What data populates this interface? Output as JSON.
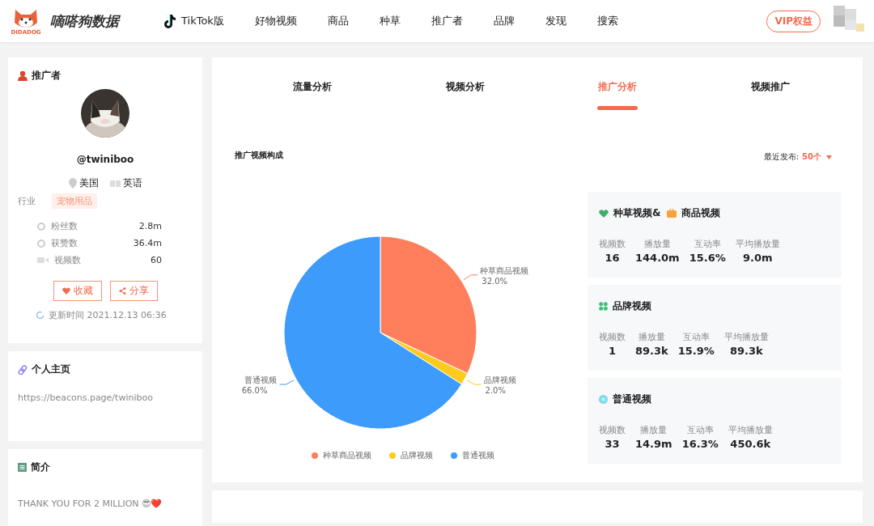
{
  "header": {
    "brand": "嘀嗒狗数据",
    "logo_caption": "DIDADOG",
    "nav": [
      {
        "label": "TikTok版",
        "kind": "tiktok"
      },
      {
        "label": "好物视频"
      },
      {
        "label": "商品"
      },
      {
        "label": "种草"
      },
      {
        "label": "推广者"
      },
      {
        "label": "品牌"
      },
      {
        "label": "发现"
      },
      {
        "label": "搜索"
      }
    ],
    "vip_button": "VIP权益"
  },
  "profile": {
    "section_title": "推广者",
    "handle": "@twiniboo",
    "country": "美国",
    "language": "英语",
    "industry_label": "行业",
    "industry": "宠物用品",
    "stats": [
      {
        "kind": "fans",
        "label": "粉丝数",
        "value": "2.8m"
      },
      {
        "kind": "likes",
        "label": "获赞数",
        "value": "36.4m"
      },
      {
        "kind": "videos",
        "label": "视频数",
        "value": "60"
      }
    ],
    "buttons": [
      {
        "kind": "favorite",
        "label": "收藏"
      },
      {
        "kind": "share",
        "label": "分享"
      }
    ],
    "updated": "更新时间 2021.12.13 06:36"
  },
  "homepage": {
    "title": "个人主页",
    "url": "https://beacons.page/twiniboo"
  },
  "bio": {
    "title": "简介",
    "text": "THANK YOU FOR 2 MILLION 😎❤️"
  },
  "tabs": [
    {
      "label": "流量分析",
      "selected": false
    },
    {
      "label": "视频分析",
      "selected": false
    },
    {
      "label": "推广分析",
      "selected": true
    },
    {
      "label": "视频推广",
      "selected": false
    }
  ],
  "composition": {
    "title": "推广视频构成",
    "recent_label": "最近发布:",
    "recent_value": "50个",
    "chart_data": {
      "type": "pie",
      "categories": [
        "种草商品视频",
        "品牌视频",
        "普通视频"
      ],
      "values": [
        32.0,
        2.0,
        66.0
      ],
      "value_labels": [
        "32.0%",
        "2.0%",
        "66.0%"
      ]
    },
    "legend": [
      {
        "label": "种草商品视频",
        "color": "#ff7f5c"
      },
      {
        "label": "品牌视频",
        "color": "#fccb1b"
      },
      {
        "label": "普通视频",
        "color": "#3d9cfb"
      }
    ],
    "cards": [
      {
        "title": [
          {
            "kind": "heart",
            "text": "种草视频&"
          },
          {
            "kind": "bag",
            "text": "商品视频"
          }
        ],
        "stats": [
          {
            "label": "视频数",
            "value": "16"
          },
          {
            "label": "播放量",
            "value": "144.0m"
          },
          {
            "label": "互动率",
            "value": "15.6%"
          },
          {
            "label": "平均播放量",
            "value": "9.0m"
          }
        ]
      },
      {
        "title": [
          {
            "kind": "grid",
            "text": "品牌视频"
          }
        ],
        "stats": [
          {
            "label": "视频数",
            "value": "1"
          },
          {
            "label": "播放量",
            "value": "89.3k"
          },
          {
            "label": "互动率",
            "value": "15.9%"
          },
          {
            "label": "平均播放量",
            "value": "89.3k"
          }
        ]
      },
      {
        "title": [
          {
            "kind": "dot",
            "text": "普通视频"
          }
        ],
        "stats": [
          {
            "label": "视频数",
            "value": "33"
          },
          {
            "label": "播放量",
            "value": "14.9m"
          },
          {
            "label": "互动率",
            "value": "16.3%"
          },
          {
            "label": "平均播放量",
            "value": "450.6k"
          }
        ]
      }
    ]
  }
}
